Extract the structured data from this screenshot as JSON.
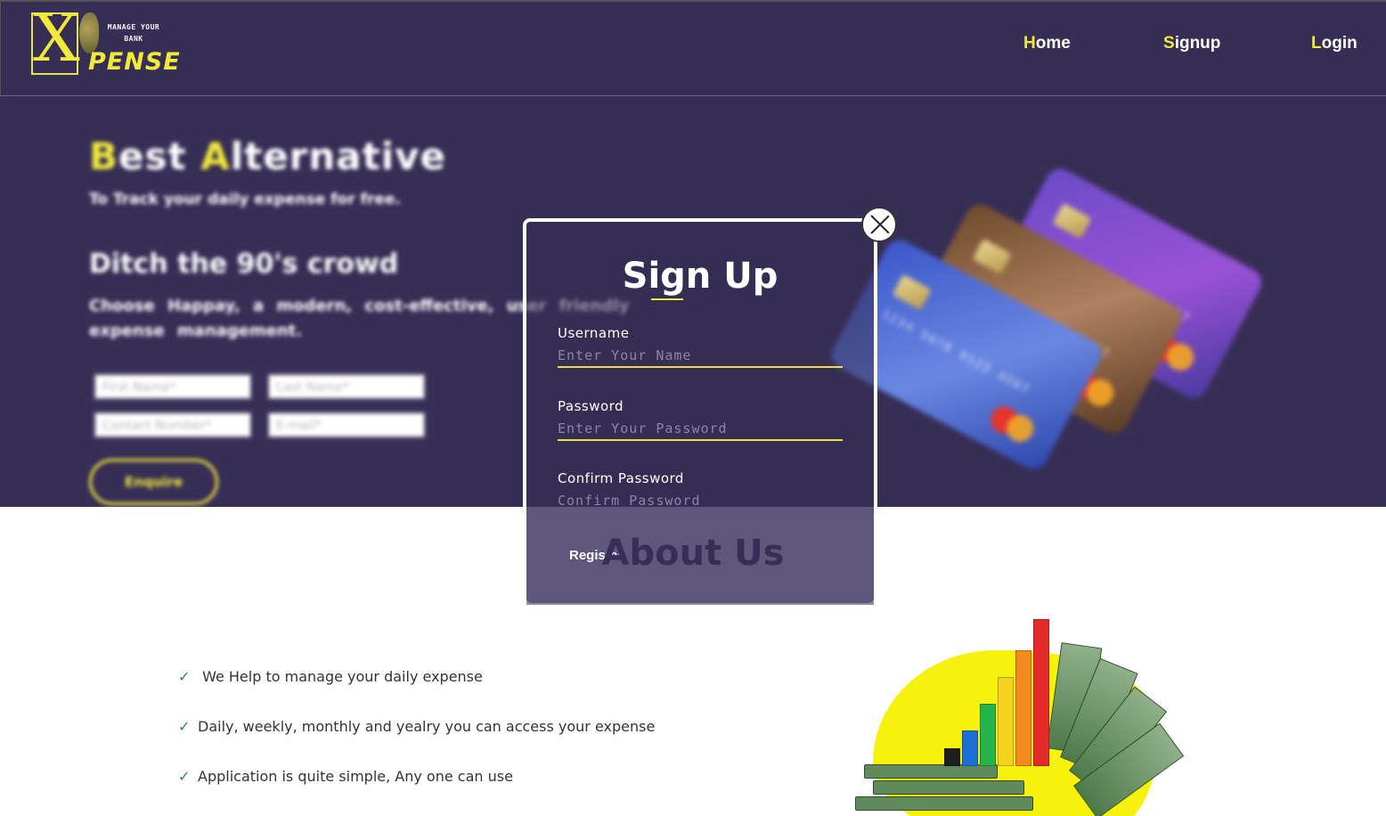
{
  "brand": {
    "logo_letter": "X",
    "logo_tagline_line1": "MANAGE YOUR",
    "logo_tagline_line2": "BANK",
    "logo_word": "PENSE"
  },
  "nav": {
    "items": [
      {
        "first": "H",
        "rest": "ome"
      },
      {
        "first": "S",
        "rest": "ignup"
      },
      {
        "first": "L",
        "rest": "ogin"
      }
    ]
  },
  "hero": {
    "title_first1": "B",
    "title_rest1": "est ",
    "title_first2": "A",
    "title_rest2": "lternative",
    "subtitle": "To Track your daily expense for free.",
    "heading": "Ditch the 90's crowd",
    "paragraph": "Choose Happay, a modern, cost-effective, user friendly expense management.",
    "fields": {
      "first_name": "First Name*",
      "last_name": "Last Name*",
      "contact": "Contact Number*",
      "email": "E-mail*"
    },
    "button": "Enquire",
    "card_number": "1234 5678 9123 4567"
  },
  "modal": {
    "title": "Sign Up",
    "username_label": "Username",
    "username_placeholder": "Enter Your Name",
    "password_label": "Password",
    "password_placeholder": "Enter Your Password",
    "confirm_label": "Confirm Password",
    "confirm_placeholder": "Confirm Password",
    "register": "Register"
  },
  "about": {
    "title": "About Us",
    "features": [
      " We Help to manage your daily expense",
      "Daily, weekly, monthly and yealry you can access your expense",
      "Application is quite simple, Any one can use"
    ]
  },
  "colors": {
    "primary": "#372e56",
    "accent": "#f1ea3b",
    "check": "#2d8a3c"
  }
}
